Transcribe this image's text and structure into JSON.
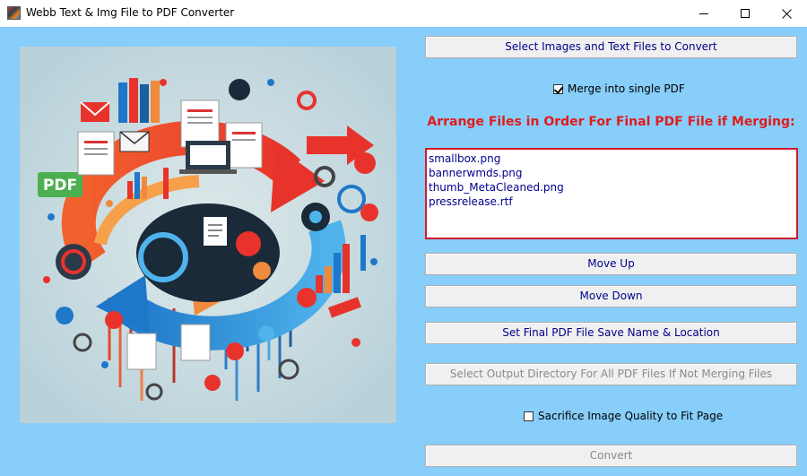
{
  "window": {
    "title": "Webb Text & Img File to PDF Converter",
    "icon": "app-icon"
  },
  "hero": {
    "icon": "pdf-conversion-illustration",
    "badge_text": "PDF"
  },
  "buttons": {
    "select_files": "Select Images and Text Files to Convert",
    "move_up": "Move Up",
    "move_down": "Move Down",
    "set_save": "Set Final PDF File Save Name & Location",
    "select_output_dir": "Select Output Directory For All PDF Files If Not Merging Files",
    "convert": "Convert"
  },
  "merge": {
    "label": "Merge into single PDF",
    "checked": true
  },
  "arrange_title": "Arrange Files in Order For Final PDF File if Merging:",
  "files": [
    "smallbox.png",
    "bannerwmds.png",
    "thumb_MetaCleaned.png",
    "pressrelease.rtf"
  ],
  "quality": {
    "label": "Sacrifice Image Quality to Fit Page",
    "checked": false
  },
  "colors": {
    "background": "#87cefa",
    "button_text": "#00008b",
    "heading": "#e31b1b",
    "listbox_border": "#d11a2a",
    "disabled_text": "#8a8a8a"
  }
}
